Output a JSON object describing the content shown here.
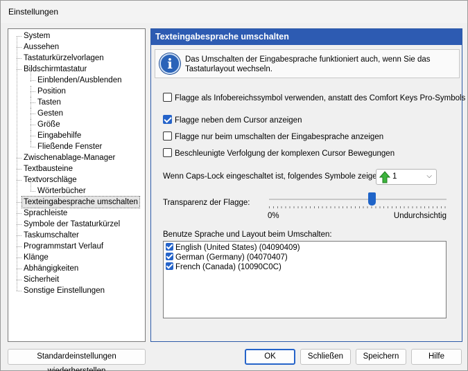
{
  "window": {
    "title": "Einstellungen"
  },
  "tree": {
    "items": [
      {
        "label": "System",
        "level": 0
      },
      {
        "label": "Aussehen",
        "level": 0
      },
      {
        "label": "Tastaturkürzelvorlagen",
        "level": 0
      },
      {
        "label": "Bildschirmtastatur",
        "level": 0
      },
      {
        "label": "Einblenden/Ausblenden",
        "level": 1
      },
      {
        "label": "Position",
        "level": 1
      },
      {
        "label": "Tasten",
        "level": 1
      },
      {
        "label": "Gesten",
        "level": 1
      },
      {
        "label": "Größe",
        "level": 1
      },
      {
        "label": "Eingabehilfe",
        "level": 1
      },
      {
        "label": "Fließende Fenster",
        "level": 1
      },
      {
        "label": "Zwischenablage-Manager",
        "level": 0
      },
      {
        "label": "Textbausteine",
        "level": 0
      },
      {
        "label": "Textvorschläge",
        "level": 0
      },
      {
        "label": "Wörterbücher",
        "level": 1
      },
      {
        "label": "Texteingabesprache umschalten",
        "level": 0,
        "selected": true
      },
      {
        "label": "Sprachleiste",
        "level": 0
      },
      {
        "label": "Symbole der Tastaturkürzel",
        "level": 0
      },
      {
        "label": "Taskumschalter",
        "level": 0
      },
      {
        "label": "Programmstart Verlauf",
        "level": 0
      },
      {
        "label": "Klänge",
        "level": 0
      },
      {
        "label": "Abhängigkeiten",
        "level": 0
      },
      {
        "label": "Sicherheit",
        "level": 0
      },
      {
        "label": "Sonstige Einstellungen",
        "level": 0
      }
    ]
  },
  "panel": {
    "header": "Texteingabesprache umschalten",
    "info_text": "Das Umschalten der Eingabesprache funktioniert auch, wenn Sie das Tastaturlayout wechseln.",
    "options": [
      {
        "label": "Flagge als Infobereichssymbol verwenden, anstatt des Comfort Keys Pro-Symbols",
        "checked": false
      },
      {
        "label": "Flagge neben dem Cursor anzeigen",
        "checked": true
      },
      {
        "label": "Flagge nur beim umschalten der Eingabesprache anzeigen",
        "checked": false
      },
      {
        "label": "Beschleunigte Verfolgung der komplexen Cursor Bewegungen",
        "checked": false
      }
    ],
    "capslock_label": "Wenn Caps-Lock eingeschaltet ist, folgendes Symbole zeigen:",
    "capslock_value": "1",
    "transparency_label": "Transparenz der Flagge:",
    "transparency_min_label": "0%",
    "transparency_max_label": "Undurchsichtig",
    "transparency_value": 0.58,
    "languages_label": "Benutze Sprache und Layout beim Umschalten:",
    "languages": [
      {
        "label": "English (United States) (04090409)",
        "checked": true
      },
      {
        "label": "German (Germany) (04070407)",
        "checked": true
      },
      {
        "label": "French (Canada) (10090C0C)",
        "checked": true
      }
    ]
  },
  "buttons": {
    "restore": "Standardeinstellungen wiederherstellen",
    "ok": "OK",
    "close": "Schließen",
    "save": "Speichern",
    "help": "Hilfe"
  },
  "colors": {
    "accent": "#2d5bb2",
    "check": "#2563c9",
    "arrow": "#3cb43c"
  }
}
